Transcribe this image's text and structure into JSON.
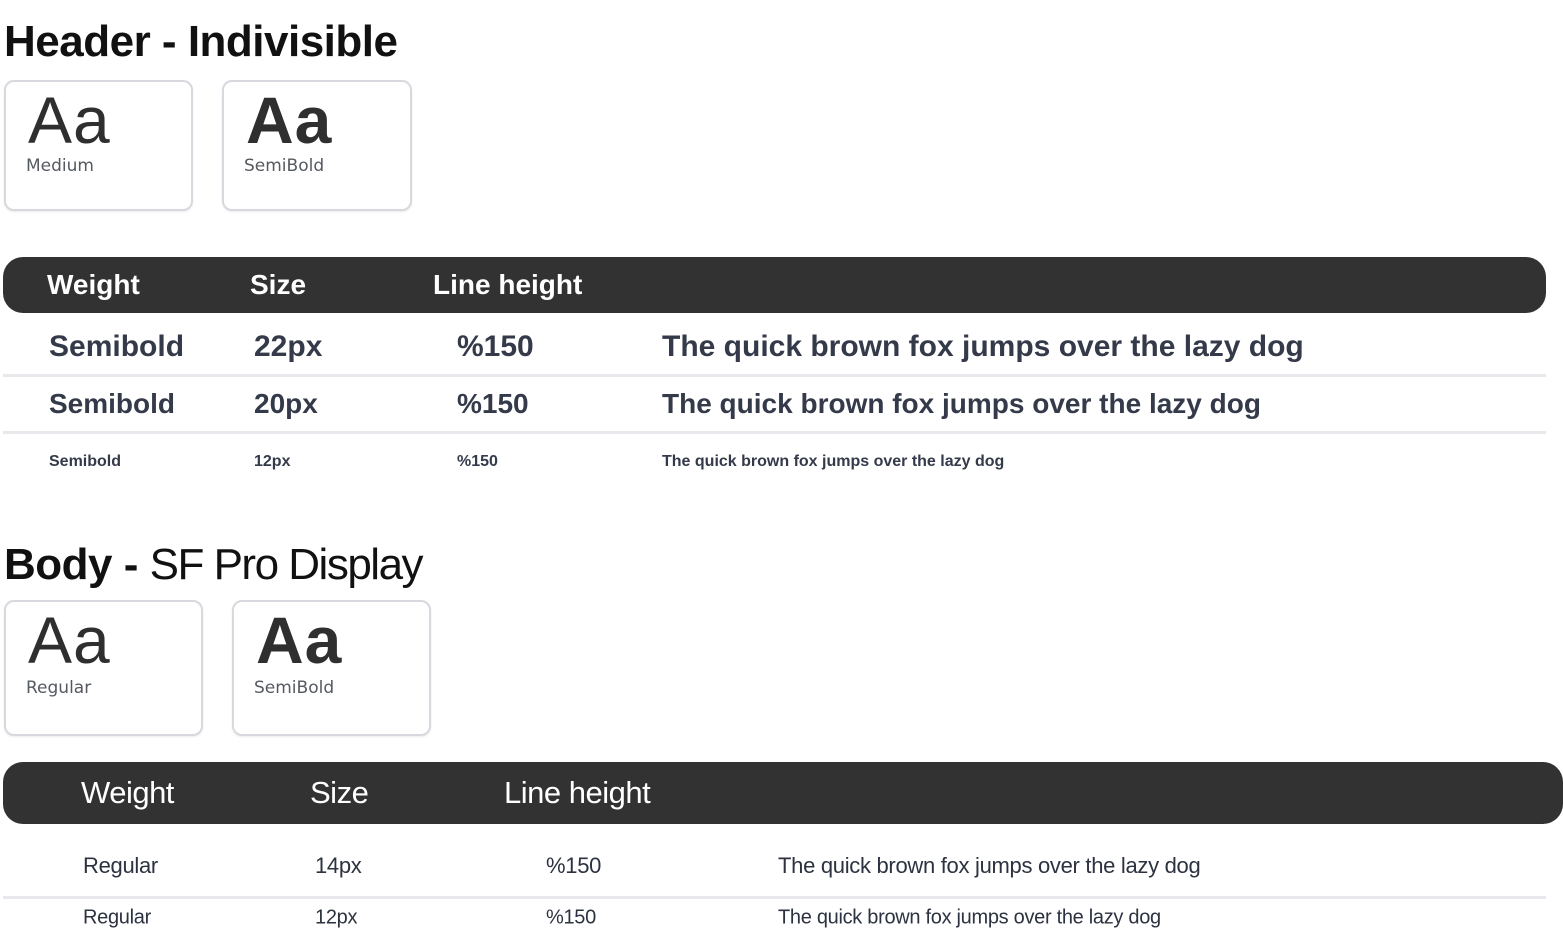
{
  "header_section": {
    "title_bold": "Header -",
    "title_font": "Indivisible",
    "cards": [
      {
        "sample": "Aa",
        "label": "Medium"
      },
      {
        "sample": "Aa",
        "label": "SemiBold"
      }
    ],
    "table": {
      "columns": [
        "Weight",
        "Size",
        "Line height"
      ],
      "rows": [
        {
          "weight": "Semibold",
          "size": "22px",
          "line_height": "%150",
          "sample": "The quick brown fox jumps over the lazy dog"
        },
        {
          "weight": "Semibold",
          "size": "20px",
          "line_height": "%150",
          "sample": "The quick brown fox jumps over the lazy dog"
        },
        {
          "weight": "Semibold",
          "size": "12px",
          "line_height": "%150",
          "sample": "The quick brown fox jumps over the lazy dog"
        }
      ]
    }
  },
  "body_section": {
    "title_bold": "Body -",
    "title_font": "SF Pro Display",
    "cards": [
      {
        "sample": "Aa",
        "label": "Regular"
      },
      {
        "sample": "Aa",
        "label": "SemiBold"
      }
    ],
    "table": {
      "columns": [
        "Weight",
        "Size",
        "Line height"
      ],
      "rows": [
        {
          "weight": "Regular",
          "size": "14px",
          "line_height": "%150",
          "sample": "The quick brown fox jumps over the lazy dog"
        },
        {
          "weight": "Regular",
          "size": "12px",
          "line_height": "%150",
          "sample": "The quick brown fox jumps over the lazy dog"
        }
      ]
    }
  },
  "colors": {
    "table_header_bg": "#323232",
    "table_header_text": "#ffffff",
    "row_text": "#343a4a",
    "divider": "#e8e9ec",
    "card_border": "#d7d9de"
  }
}
